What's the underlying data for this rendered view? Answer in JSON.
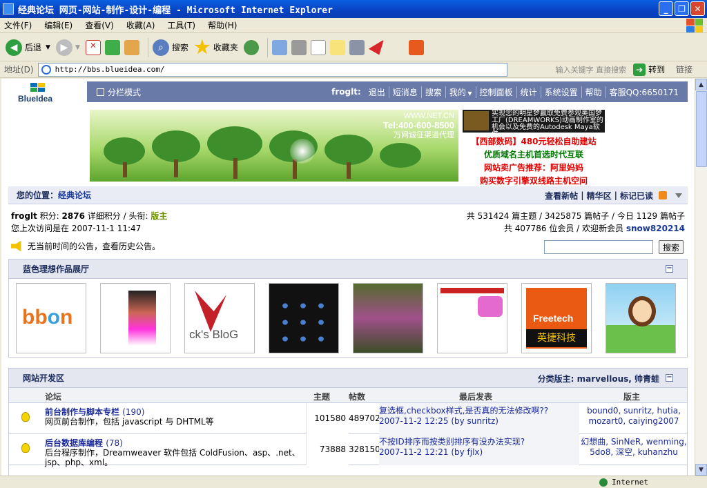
{
  "window": {
    "title": "经典论坛 网页-网站-制作-设计-编程 - Microsoft Internet Explorer"
  },
  "menu": [
    "文件(F)",
    "编辑(E)",
    "查看(V)",
    "收藏(A)",
    "工具(T)",
    "帮助(H)"
  ],
  "toolbar": {
    "back": "后退",
    "search": "搜索",
    "favorites": "收藏夹"
  },
  "address": {
    "label": "地址(D)",
    "url": "http://bbs.blueidea.com/",
    "hint": "输入关键字 直接搜索",
    "go": "转到",
    "links": "链接"
  },
  "site": {
    "logo": "BlueIdea",
    "mode": "分栏模式",
    "user": "froglt:",
    "nav": [
      "退出",
      "短消息",
      "搜索",
      "我的",
      "控制面板",
      "统计",
      "系统设置",
      "帮助",
      "客服QQ:6650171"
    ]
  },
  "banner": {
    "url": "WWW.NET.CN",
    "tel": "Tel:400-600-8500",
    "agent": "万网诚征渠道代理"
  },
  "ad_image": {
    "text": "实现您的明星梦赢取免费参观美国梦工厂(DREAMWORKS)动画制作室的机会以及免费的Autodesk Maya软件"
  },
  "text_ads": [
    {
      "text": "【西部数码】480元轻松自助建站",
      "color": "#e00000"
    },
    {
      "text": "优质域名主机首选时代互联",
      "color": "#007a00"
    },
    {
      "text": "网站卖广告推荐：阿里妈妈",
      "color": "#e00000"
    },
    {
      "text": "购买数字引擎双线路主机空间",
      "color": "#e00000"
    }
  ],
  "crumb": {
    "label": "您的位置：",
    "link": "经典论坛",
    "right": [
      "查看新帖",
      "精华区",
      "标记已读"
    ]
  },
  "user": {
    "name": "froglt",
    "points_label": "积分:",
    "points": "2876",
    "detail": "详细积分 / 头衔:",
    "title": "版主",
    "last_visit": "您上次访问是在 2007-11-1 11:47"
  },
  "stats": {
    "line1": "共 531424 篇主题 / 3425875 篇帖子 / 今日 1129 篇帖子",
    "line2": "共 407786 位会员 / 欢迎新会员",
    "new_member": "snow820214"
  },
  "announce": {
    "text": "无当前时间的公告，查看历史公告。"
  },
  "search": {
    "button": "搜索"
  },
  "gallery": {
    "title": "蓝色理想作品展厅",
    "items": [
      "bbon.cn",
      "fashion illustration",
      "ck's BloG",
      "Mobile Phone Icon Design",
      "pink flowers",
      "web layout",
      "Freetech 英捷科技",
      "cartoon girl"
    ]
  },
  "forum_section": {
    "title": "网站开发区",
    "moderators": "分类版主: marvellous, 帅青蛙",
    "columns": [
      "论坛",
      "主题",
      "帖数",
      "最后发表",
      "版主"
    ],
    "rows": [
      {
        "name": "前台制作与脚本专栏",
        "count": "(190)",
        "desc": "网页前台制作，包括 javascript 与 DHTML等",
        "topics": "101580",
        "posts": "489702",
        "last_title": "复选框,checkbox样式,是否真的无法修改啊??",
        "last_meta": "2007-11-2 12:25 (by sunritz)",
        "mods_line1": "bound0, sunritz, hutia,",
        "mods_line2": "mozart0, caiying2007"
      },
      {
        "name": "后台数据库编程",
        "count": "(78)",
        "desc": "后台程序制作，Dreamweaver 软件包括 ColdFusion、asp、.net、jsp、php、xml。",
        "topics": "73888",
        "posts": "328150",
        "last_title": "不按ID排序而按类别排序有没办法实现?",
        "last_meta": "2007-11-2 12:21 (by fjlx)",
        "mods_line1": "幻想曲, SinNeR, wenming,",
        "mods_line2": "5do8, 深空, kuhanzhu"
      }
    ]
  },
  "status": {
    "zone": "Internet"
  }
}
